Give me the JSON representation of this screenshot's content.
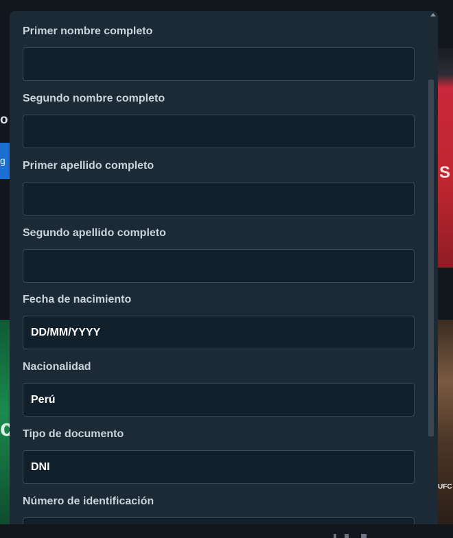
{
  "background": {
    "left_text": "o",
    "left_button_text": "g",
    "left_promo_text": "c",
    "right_promo_text": "S",
    "right_badge_text": "UFC"
  },
  "form": {
    "fields": [
      {
        "id": "first-name",
        "label": "Primer nombre completo",
        "value": "",
        "placeholder": ""
      },
      {
        "id": "second-name",
        "label": "Segundo nombre completo",
        "value": "",
        "placeholder": ""
      },
      {
        "id": "first-surname",
        "label": "Primer apellido completo",
        "value": "",
        "placeholder": ""
      },
      {
        "id": "second-surname",
        "label": "Segundo apellido completo",
        "value": "",
        "placeholder": ""
      },
      {
        "id": "birth-date",
        "label": "Fecha de nacimiento",
        "value": "",
        "placeholder": "DD/MM/YYYY"
      },
      {
        "id": "nationality",
        "label": "Nacionalidad",
        "value": "Perú",
        "placeholder": ""
      },
      {
        "id": "document-type",
        "label": "Tipo de documento",
        "value": "DNI",
        "placeholder": ""
      },
      {
        "id": "id-number",
        "label": "Número de identificación",
        "value": "",
        "placeholder": ""
      }
    ]
  }
}
